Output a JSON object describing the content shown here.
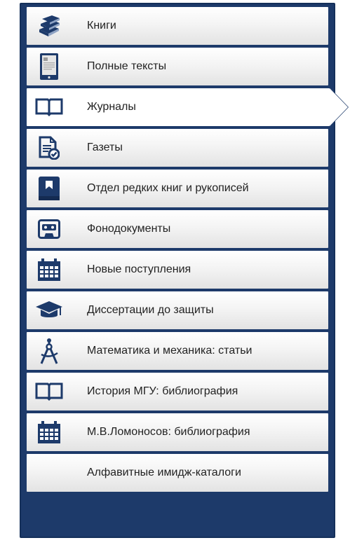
{
  "menu": {
    "items": [
      {
        "label": "Книги",
        "icon": "books-icon"
      },
      {
        "label": "Полные тексты",
        "icon": "tablet-icon"
      },
      {
        "label": "Журналы",
        "icon": "open-book-icon",
        "active": true
      },
      {
        "label": "Газеты",
        "icon": "document-check-icon"
      },
      {
        "label": "Отдел редких книг и рукописей",
        "icon": "bookmarked-book-icon"
      },
      {
        "label": "Фонодокументы",
        "icon": "cassette-icon"
      },
      {
        "label": "Новые поступления",
        "icon": "calendar-icon"
      },
      {
        "label": "Диссертации до защиты",
        "icon": "graduation-cap-icon"
      },
      {
        "label": "Математика и механика: статьи",
        "icon": "compass-icon"
      },
      {
        "label": "История МГУ: библиография",
        "icon": "open-book-icon"
      },
      {
        "label": "М.В.Ломоносов: библиография",
        "icon": "calendar-icon"
      },
      {
        "label": "Алфавитные имидж-каталоги",
        "icon": ""
      }
    ]
  },
  "colors": {
    "panel": "#1d3a6a",
    "icon": "#1d3a6a",
    "text": "#222222",
    "active_bg": "#ffffff"
  }
}
